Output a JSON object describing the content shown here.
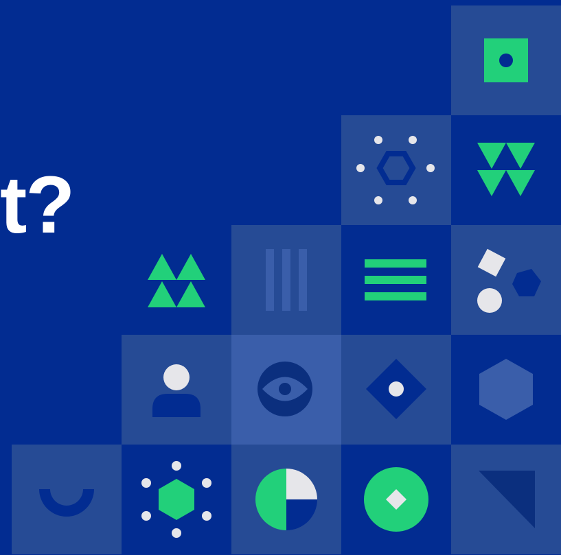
{
  "headline": {
    "text": "t?"
  },
  "colors": {
    "background": "#022c91",
    "tile_light": "#264b95",
    "tile_mid": "#3a5eaa",
    "green": "#22d07a",
    "white": "#e6e6ea",
    "dark_blue": "#0b2f7e"
  },
  "tiles": [
    {
      "icon": "square-dot-icon"
    },
    {
      "icon": "hexagon-dots-icon"
    },
    {
      "icon": "down-triangles-icon"
    },
    {
      "icon": "up-triangles-icon"
    },
    {
      "icon": "vertical-bars-icon"
    },
    {
      "icon": "horizontal-bars-icon"
    },
    {
      "icon": "shapes-cluster-icon"
    },
    {
      "icon": "person-icon"
    },
    {
      "icon": "eye-icon"
    },
    {
      "icon": "diamond-dot-icon"
    },
    {
      "icon": "hexagon-icon"
    },
    {
      "icon": "half-circle-icon"
    },
    {
      "icon": "hexagon-molecule-icon"
    },
    {
      "icon": "pie-chart-icon"
    },
    {
      "icon": "circle-diamond-icon"
    },
    {
      "icon": "corner-triangle-icon"
    }
  ]
}
